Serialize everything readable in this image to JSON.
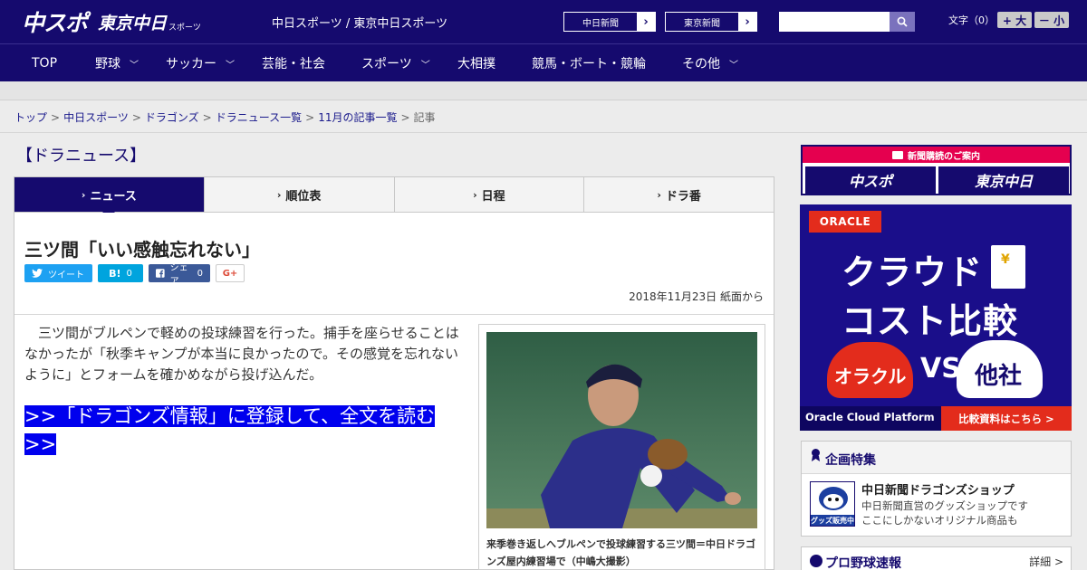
{
  "header": {
    "logo_main": "中スポ",
    "logo_tokyo": "東京中日",
    "logo_sports": "スポーツ",
    "site_names": "中日スポーツ / 東京中日スポーツ",
    "paper_links": [
      "中日新聞",
      "東京新聞"
    ],
    "search": {
      "placeholder": "",
      "button_icon": "search-icon"
    },
    "font_size_label": "文字（0）",
    "font_larger": "+ 大",
    "font_smaller": "－ 小"
  },
  "nav": [
    {
      "label": "TOP",
      "has_dropdown": false
    },
    {
      "label": "野球",
      "has_dropdown": true
    },
    {
      "label": "サッカー",
      "has_dropdown": true
    },
    {
      "label": "芸能・社会",
      "has_dropdown": false
    },
    {
      "label": "スポーツ",
      "has_dropdown": true
    },
    {
      "label": "大相撲",
      "has_dropdown": false
    },
    {
      "label": "競馬・ボート・競輪",
      "has_dropdown": false
    },
    {
      "label": "その他",
      "has_dropdown": true
    }
  ],
  "breadcrumb": {
    "items": [
      "トップ",
      "中日スポーツ",
      "ドラゴンズ",
      "ドラニュース一覧",
      "11月の記事一覧"
    ],
    "current": "記事",
    "separator": ">"
  },
  "section_title": "【ドラニュース】",
  "tabs": [
    {
      "label": "ニュース",
      "active": true
    },
    {
      "label": "順位表",
      "active": false
    },
    {
      "label": "日程",
      "active": false
    },
    {
      "label": "ドラ番",
      "active": false
    }
  ],
  "article": {
    "headline": "三ツ間「いい感触忘れない」",
    "share": {
      "tweet": "ツイート",
      "hatena_icon": "B!",
      "hatena_count": "0",
      "facebook": "シェア",
      "facebook_count": "0",
      "gplus": "G+"
    },
    "dateline": "2018年11月23日 紙面から",
    "body": "三ツ間がブルペンで軽めの投球練習を行った。捕手を座らせることはなかったが「秋季キャンプが本当に良かったので。その感覚を忘れないように」とフォームを確かめながら投げ込んだ。",
    "cta": ">>「ドラゴンズ情報」に登録して、全文を読む >>",
    "photo_caption": "来季巻き返しへブルペンで投球練習する三ツ間＝中日ドラゴンズ屋内練習場で（中嶋大撮影）"
  },
  "sidebar": {
    "promo": {
      "header": "新聞購読のご案内",
      "logo_left": "中スポ",
      "logo_right": "東京中日"
    },
    "ad": {
      "brand": "ORACLE",
      "headline_1": "クラウド",
      "headline_2": "コスト比較",
      "left_label": "オラクル",
      "vs": "VS",
      "right_label": "他社",
      "footer_left": "Oracle Cloud Platform",
      "footer_right": "比較資料はこちら >",
      "colors": {
        "bg": "#1a0e8a",
        "red": "#e32c1c"
      }
    },
    "feature": {
      "title": "企画特集",
      "shop_title": "中日新聞ドラゴンズショップ",
      "shop_desc_1": "中日新聞直営のグッズショップです",
      "shop_desc_2": "ここにしかないオリジナル商品も",
      "thumb_label": "グッズ販売中"
    },
    "scores": {
      "title": "プロ野球速報",
      "more": "詳細 >"
    }
  },
  "colors": {
    "brand_navy": "#150a6e",
    "link_blue": "#1a1a8c",
    "cta_blue": "#0000ee",
    "twitter": "#1da1f2",
    "hatena": "#00a4de",
    "facebook": "#3b5998"
  }
}
